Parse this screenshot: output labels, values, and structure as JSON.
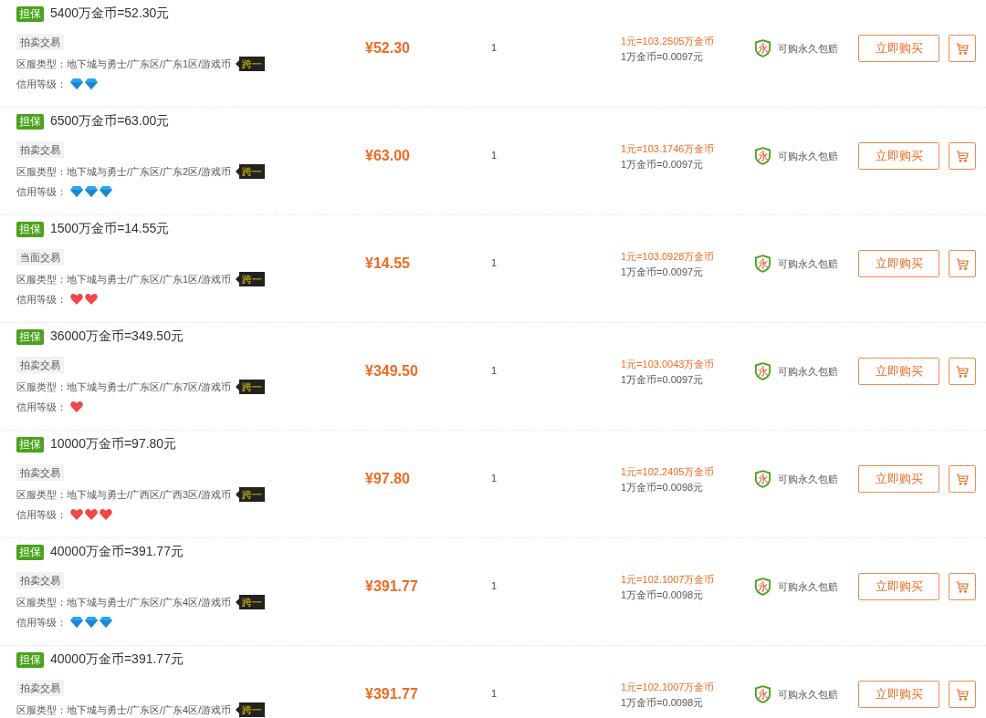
{
  "listings": [
    {
      "escrow_badge": "担保",
      "title": "5400万金币=52.30元",
      "trade_type": "拍卖交易",
      "server": "区服类型：地下城与勇士/广东区/广东1区/游戏币",
      "cross_tag": "跨一",
      "credit": {
        "label": "信用等级：",
        "icons": [
          {
            "kind": "diamond"
          },
          {
            "kind": "diamond"
          }
        ]
      },
      "price": "¥52.30",
      "quantity": "1",
      "ratio": "1元=103.2505万金币",
      "unit_price": "1万金币=0.0097元",
      "guarantee_icon": "永",
      "guarantee": "可购永久包赔",
      "buy_button": "立即购买"
    },
    {
      "escrow_badge": "担保",
      "title": "6500万金币=63.00元",
      "trade_type": "拍卖交易",
      "server": "区服类型：地下城与勇士/广东区/广东2区/游戏币",
      "cross_tag": "跨一",
      "credit": {
        "label": "信用等级：",
        "icons": [
          {
            "kind": "diamond"
          },
          {
            "kind": "diamond"
          },
          {
            "kind": "diamond"
          }
        ]
      },
      "price": "¥63.00",
      "quantity": "1",
      "ratio": "1元=103.1746万金币",
      "unit_price": "1万金币=0.0097元",
      "guarantee_icon": "永",
      "guarantee": "可购永久包赔",
      "buy_button": "立即购买"
    },
    {
      "escrow_badge": "担保",
      "title": "1500万金币=14.55元",
      "trade_type": "当面交易",
      "server": "区服类型：地下城与勇士/广东区/广东1区/游戏币",
      "cross_tag": "跨一",
      "credit": {
        "label": "信用等级：",
        "icons": [
          {
            "kind": "heart"
          },
          {
            "kind": "heart"
          }
        ]
      },
      "price": "¥14.55",
      "quantity": "1",
      "ratio": "1元=103.0928万金币",
      "unit_price": "1万金币=0.0097元",
      "guarantee_icon": "永",
      "guarantee": "可购永久包赔",
      "buy_button": "立即购买"
    },
    {
      "escrow_badge": "担保",
      "title": "36000万金币=349.50元",
      "trade_type": "拍卖交易",
      "server": "区服类型：地下城与勇士/广东区/广东7区/游戏币",
      "cross_tag": "跨一",
      "credit": {
        "label": "信用等级：",
        "icons": [
          {
            "kind": "heart"
          }
        ]
      },
      "price": "¥349.50",
      "quantity": "1",
      "ratio": "1元=103.0043万金币",
      "unit_price": "1万金币=0.0097元",
      "guarantee_icon": "永",
      "guarantee": "可购永久包赔",
      "buy_button": "立即购买"
    },
    {
      "escrow_badge": "担保",
      "title": "10000万金币=97.80元",
      "trade_type": "拍卖交易",
      "server": "区服类型：地下城与勇士/广西区/广西3区/游戏币",
      "cross_tag": "跨一",
      "credit": {
        "label": "信用等级：",
        "icons": [
          {
            "kind": "heart"
          },
          {
            "kind": "heart"
          },
          {
            "kind": "heart"
          }
        ]
      },
      "price": "¥97.80",
      "quantity": "1",
      "ratio": "1元=102.2495万金币",
      "unit_price": "1万金币=0.0098元",
      "guarantee_icon": "永",
      "guarantee": "可购永久包赔",
      "buy_button": "立即购买"
    },
    {
      "escrow_badge": "担保",
      "title": "40000万金币=391.77元",
      "trade_type": "拍卖交易",
      "server": "区服类型：地下城与勇士/广东区/广东4区/游戏币",
      "cross_tag": "跨一",
      "credit": {
        "label": "信用等级：",
        "icons": [
          {
            "kind": "diamond"
          },
          {
            "kind": "diamond"
          },
          {
            "kind": "diamond"
          }
        ]
      },
      "price": "¥391.77",
      "quantity": "1",
      "ratio": "1元=102.1007万金币",
      "unit_price": "1万金币=0.0098元",
      "guarantee_icon": "永",
      "guarantee": "可购永久包赔",
      "buy_button": "立即购买"
    },
    {
      "escrow_badge": "担保",
      "title": "40000万金币=391.77元",
      "trade_type": "拍卖交易",
      "server": "区服类型：地下城与勇士/广东区/广东4区/游戏币",
      "cross_tag": "跨一",
      "price": "¥391.77",
      "quantity": "1",
      "ratio": "1元=102.1007万金币",
      "unit_price": "1万金币=0.0098元",
      "guarantee_icon": "永",
      "guarantee": "可购永久包赔",
      "buy_button": "立即购买"
    }
  ]
}
